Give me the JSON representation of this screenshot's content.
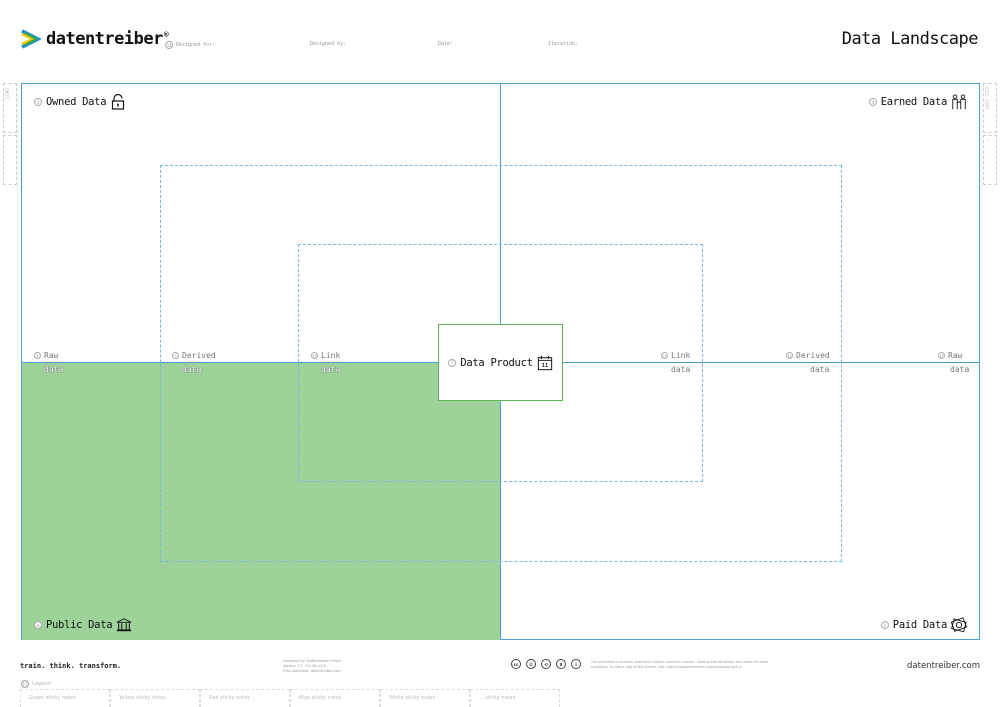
{
  "header": {
    "brand": "datentreiber",
    "brand_mark": "®",
    "title": "Data Landscape",
    "fields": [
      {
        "num": "14",
        "label": "Designed for:"
      },
      {
        "label": "Designed by:"
      },
      {
        "label": "Date:"
      },
      {
        "label": "Iteration:"
      }
    ]
  },
  "side_tabs": {
    "left": [
      "START",
      "—"
    ],
    "right": [
      "NEXT STEP",
      "—"
    ]
  },
  "quadrants": {
    "owned": {
      "num": "5",
      "label": "Owned Data",
      "icon": "lock-icon"
    },
    "earned": {
      "num": "4",
      "label": "Earned Data",
      "icon": "partners-icon"
    },
    "public": {
      "num": "6",
      "label": "Public Data",
      "icon": "bank-icon"
    },
    "paid": {
      "num": "3",
      "label": "Paid Data",
      "icon": "money-icon"
    }
  },
  "rings": {
    "left": [
      {
        "num": "8",
        "label": "Raw",
        "sub": "data"
      },
      {
        "num": "9",
        "label": "Derived",
        "sub": "data"
      },
      {
        "num": "10",
        "label": "Link",
        "sub": "data"
      }
    ],
    "right": [
      {
        "num": "12",
        "label": "Link",
        "sub": "data"
      },
      {
        "num": "11",
        "label": "Derived",
        "sub": "data"
      },
      {
        "num": "13",
        "label": "Raw",
        "sub": "data"
      }
    ]
  },
  "product": {
    "num": "7",
    "label": "Data Product",
    "icon": "calendar-icon",
    "icon_text": "11"
  },
  "colors": {
    "accent_blue": "#4a9fd4",
    "public_green": "#9dd39a",
    "product_border": "#5fb45a"
  },
  "footer": {
    "tagline": "train. think. transform.",
    "credits": [
      "Designed by: Datentreiber GmbH",
      "Version 7.1 · 01.06.2024",
      "Free download: datentreiber.com"
    ],
    "cc": [
      "cc",
      "©",
      "⟲",
      "$",
      "i"
    ],
    "license": "This worksheet is licensed under the Creative Commons License - Sharing with attribution and under the same conditions. To view a copy of this license, visit: http://creativecommons.org/licenses/by-sa/4.0/",
    "site": "datentreiber.com",
    "legend_num": "15",
    "legend_title": "Legend:",
    "legend": [
      "Green sticky notes",
      "Yellow sticky notes",
      "Red sticky notes",
      "Blue sticky notes",
      "White sticky notes",
      "... sticky notes"
    ]
  }
}
